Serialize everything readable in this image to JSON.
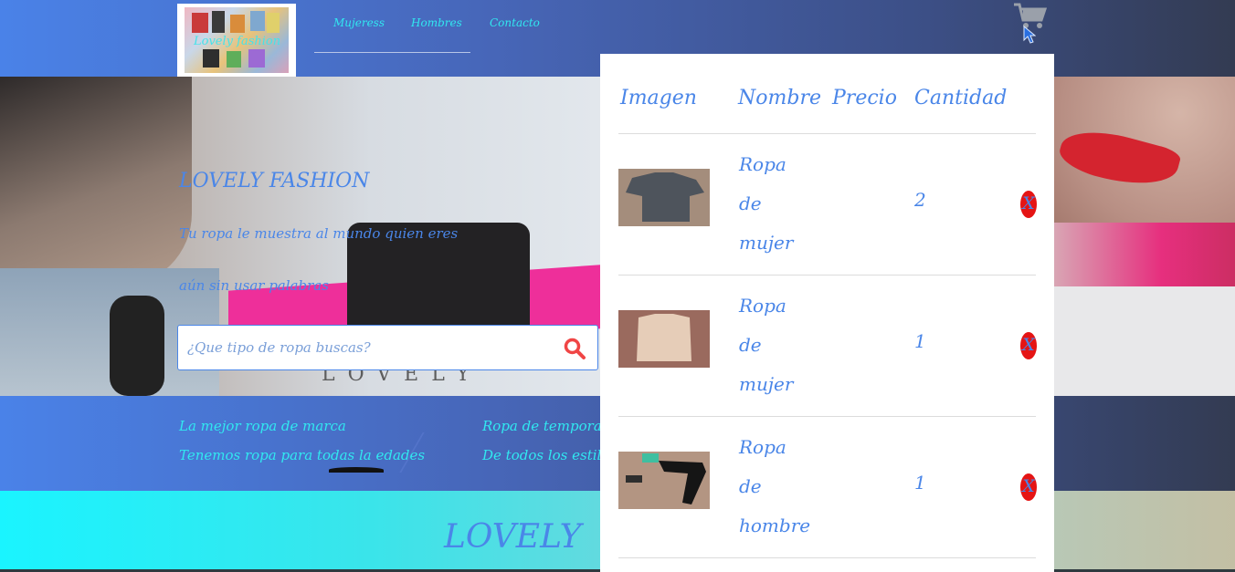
{
  "header": {
    "logo_text": "Lovely fashion",
    "nav": [
      {
        "label": "Mujeress"
      },
      {
        "label": "Hombres"
      },
      {
        "label": "Contacto"
      }
    ]
  },
  "hero": {
    "title": "LOVELY FASHION",
    "tagline_1": "Tu ropa le muestra al mundo quien eres",
    "tagline_2": "aún sin usar palabras",
    "backdrop_text": "LOVELY",
    "search_placeholder": "¿Que tipo de ropa buscas?"
  },
  "features": [
    "La mejor ropa de marca",
    "Tenemos ropa para todas la edades",
    "Ropa de temporada",
    "De todos los estilos"
  ],
  "banner": {
    "title": "LOVELY"
  },
  "cart": {
    "headers": {
      "image": "Imagen",
      "name": "Nombre",
      "price": "Precio",
      "quantity": "Cantidad"
    },
    "items": [
      {
        "name_lines": [
          "Ropa",
          "de",
          "mujer"
        ],
        "price": "",
        "quantity": "2",
        "remove_label": "X",
        "thumb": "gray-top"
      },
      {
        "name_lines": [
          "Ropa",
          "de",
          "mujer"
        ],
        "price": "",
        "quantity": "1",
        "remove_label": "X",
        "thumb": "beige-top"
      },
      {
        "name_lines": [
          "Ropa",
          "de",
          "hombre"
        ],
        "price": "",
        "quantity": "1",
        "remove_label": "X",
        "thumb": "black-pants"
      }
    ]
  },
  "colors": {
    "accent": "#4a86e8",
    "cyan_text": "#31e8f0",
    "remove_button": "#e51414"
  },
  "icons": {
    "cart": "shopping-cart-icon",
    "search": "search-icon",
    "pointer": "mouse-pointer-icon"
  }
}
